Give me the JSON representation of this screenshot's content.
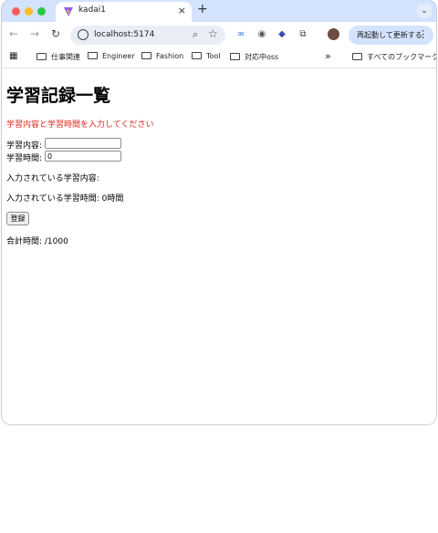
{
  "browser": {
    "tab_title": "kadai1",
    "tab_close": "×",
    "new_tab": "+",
    "tab_menu": "⌄",
    "url": "localhost:5174",
    "update_button": "再起動して更新する",
    "bookmarks": [
      "仕事関連",
      "Engineer",
      "Fashion",
      "Tool",
      "対応中oss"
    ],
    "bookmarks_overflow": "»",
    "all_bookmarks": "すべてのブックマーク",
    "colors": {
      "tabbar": "#d3e3fd",
      "close": "#ff5f57",
      "minimize": "#febc2e",
      "zoom": "#28c840"
    }
  },
  "page": {
    "title": "学習記録一覧",
    "error": "学習内容と学習時間を入力してください",
    "content_label": "学習内容:",
    "content_value": "",
    "time_label": "学習時間:",
    "time_value": "0",
    "entered_content_label": "入力されている学習内容:",
    "entered_time_label": "入力されている学習時間: 0時間",
    "register_button": "登録",
    "total_label": "合計時間: /1000",
    "error_color": "#e0251b"
  }
}
